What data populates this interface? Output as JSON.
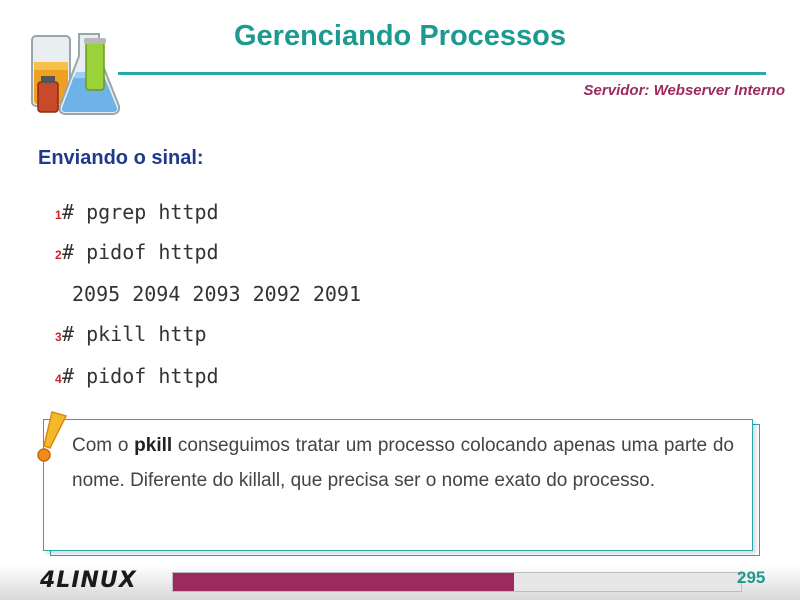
{
  "header": {
    "title": "Gerenciando Processos",
    "subtitle": "Servidor: Webserver Interno",
    "logo_icon": "lab-beakers-icon"
  },
  "section": {
    "heading": "Enviando o sinal:"
  },
  "commands": [
    {
      "num": "1",
      "text": "# pgrep httpd"
    },
    {
      "num": "2",
      "text": "# pidof httpd"
    },
    {
      "num": "3",
      "text": "# pkill http"
    },
    {
      "num": "4",
      "text": "# pidof httpd"
    }
  ],
  "output_line": "2095 2094 2093 2092 2091",
  "note": {
    "icon": "exclamation-icon",
    "text_before": "Com o ",
    "bold": "pkill",
    "text_after": " conseguimos tratar um processo colocando apenas uma parte do nome.  Diferente do killall, que precisa ser o nome exato do processo."
  },
  "footer": {
    "logo_text": "4LINUX",
    "page_number": "295",
    "progress_fraction": 0.6
  },
  "colors": {
    "title": "#1c9a8f",
    "subtitle": "#9b2a5e",
    "heading": "#1f3a8a",
    "line_number": "#d0202a",
    "accent_line": "#2aa8a8",
    "progress": "#9b2a5e"
  }
}
